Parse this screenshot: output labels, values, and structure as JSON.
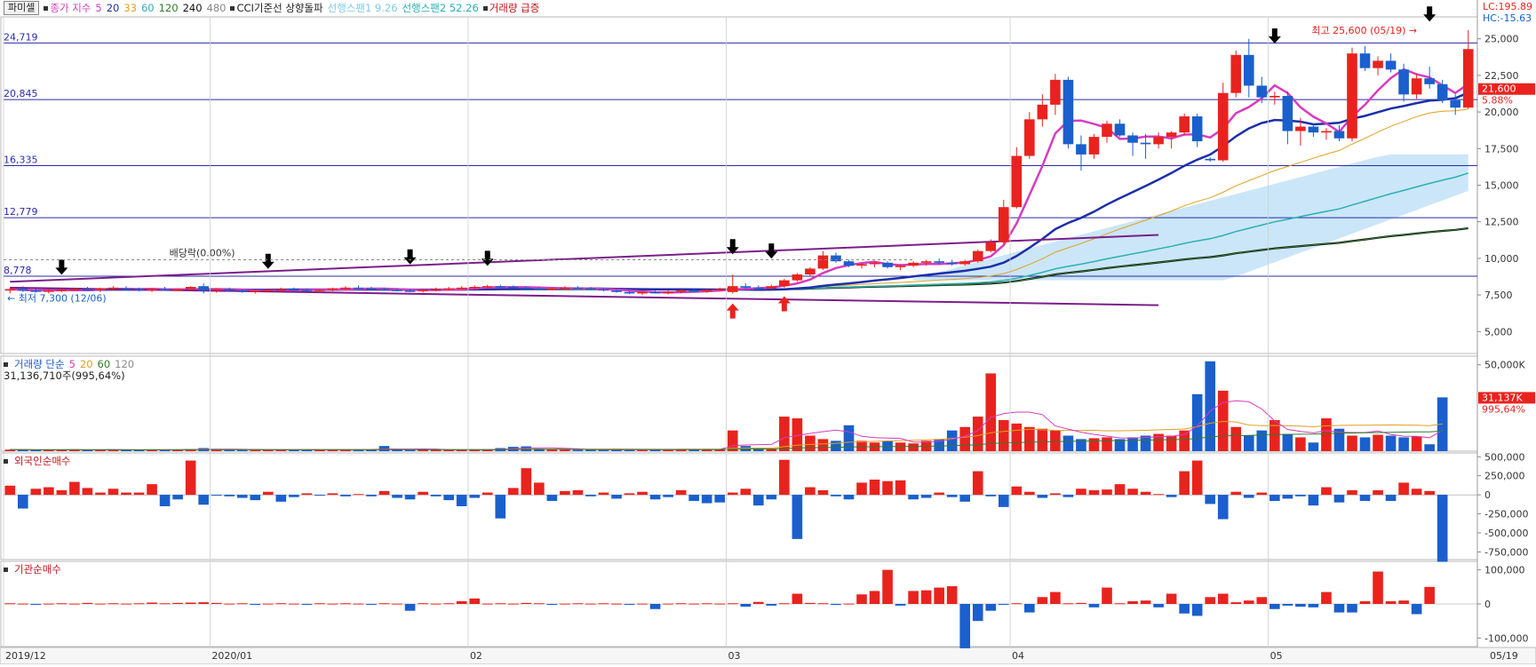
{
  "legend": {
    "stock_tag": "파미셀",
    "price_label": "종가 지수",
    "ma_periods": [
      "5",
      "20",
      "33",
      "60",
      "120",
      "240",
      "480"
    ],
    "ma_colors": [
      "#d63cc0",
      "#1b2fa8",
      "#e0a020",
      "#2ab0b0",
      "#2f7a2f",
      "#111111",
      "#888888"
    ],
    "cci_label": "CCI기준선 상향돌파",
    "span1_label": "선행스팬1 9.26",
    "span2_label": "선행스팬2 52.26",
    "vol_surge_label": "거래량 급증"
  },
  "price_info": {
    "lc": "LC:195.89",
    "hc": "HC:-15.63"
  },
  "colors": {
    "up": "#e8231e",
    "down": "#1a5fcc",
    "hline": "#2a2aa8",
    "span": "#8cc8f0",
    "conv": "#5fc8e0",
    "purple": "#7a1e8a"
  },
  "chart_data": [
    {
      "type": "candlestick",
      "pane": "price",
      "ylim": [
        3500,
        26500
      ],
      "yticks": [
        "25,000",
        "22,500",
        "20,000",
        "17,500",
        "15,000",
        "12,500",
        "10,000",
        "7,500",
        "5,000"
      ],
      "ytick_values": [
        25000,
        22500,
        20000,
        17500,
        15000,
        12500,
        10000,
        7500,
        5000
      ],
      "hlines": [
        {
          "label": "24,719",
          "value": 24719
        },
        {
          "label": "20,845",
          "value": 20845
        },
        {
          "label": "16,335",
          "value": 16335
        },
        {
          "label": "12,779",
          "value": 12779
        },
        {
          "label": "8,778",
          "value": 8778
        }
      ],
      "current_price": {
        "label": "21,600",
        "value": 21600,
        "pct": "5.88%"
      },
      "annotations": {
        "high": "최고 25,600 (05/19)",
        "low": "최저 7,300 (12/06)",
        "dividend": "배당락(0.00%)"
      },
      "x_labels": [
        {
          "label": "2019/12",
          "i": 0
        },
        {
          "label": "2020/01",
          "i": 16
        },
        {
          "label": "02",
          "i": 36
        },
        {
          "label": "03",
          "i": 56
        },
        {
          "label": "04",
          "i": 78
        },
        {
          "label": "05",
          "i": 98
        },
        {
          "label": "05/19",
          "i": 109
        }
      ],
      "candles": [
        [
          7800,
          8000,
          7600,
          7900
        ],
        [
          7900,
          8100,
          7700,
          7800
        ],
        [
          7800,
          7950,
          7650,
          7750
        ],
        [
          7750,
          7900,
          7600,
          7800
        ],
        [
          7800,
          7950,
          7700,
          7850
        ],
        [
          7850,
          8000,
          7750,
          7900
        ],
        [
          7900,
          8050,
          7800,
          7850
        ],
        [
          7850,
          8000,
          7700,
          7950
        ],
        [
          7950,
          8100,
          7850,
          8000
        ],
        [
          7950,
          8100,
          7800,
          7900
        ],
        [
          7900,
          8000,
          7750,
          7800
        ],
        [
          7800,
          7950,
          7700,
          7900
        ],
        [
          7900,
          8050,
          7800,
          7850
        ],
        [
          7850,
          7950,
          7750,
          7900
        ],
        [
          7900,
          8100,
          7800,
          8050
        ],
        [
          8100,
          8300,
          7600,
          7800
        ],
        [
          7800,
          7950,
          7650,
          7900
        ],
        [
          7900,
          8000,
          7750,
          7800
        ],
        [
          7800,
          7900,
          7650,
          7700
        ],
        [
          7700,
          7850,
          7600,
          7800
        ],
        [
          7800,
          7950,
          7700,
          7850
        ],
        [
          7850,
          8000,
          7750,
          7900
        ],
        [
          7900,
          8000,
          7800,
          7850
        ],
        [
          7850,
          7950,
          7750,
          7800
        ],
        [
          7800,
          7900,
          7700,
          7850
        ],
        [
          7850,
          8000,
          7750,
          7950
        ],
        [
          7950,
          8100,
          7850,
          8000
        ],
        [
          8000,
          8150,
          7900,
          7950
        ],
        [
          7950,
          8050,
          7850,
          7900
        ],
        [
          7900,
          8000,
          7800,
          7850
        ],
        [
          7850,
          7950,
          7750,
          7800
        ],
        [
          7800,
          7900,
          7700,
          7750
        ],
        [
          7750,
          7900,
          7650,
          7850
        ],
        [
          7850,
          8000,
          7750,
          7900
        ],
        [
          7900,
          8050,
          7800,
          7950
        ],
        [
          7950,
          8100,
          7850,
          8000
        ],
        [
          8000,
          8150,
          7900,
          8050
        ],
        [
          8050,
          8200,
          7950,
          8100
        ],
        [
          8100,
          8200,
          8000,
          8050
        ],
        [
          8050,
          8150,
          7950,
          8000
        ],
        [
          8000,
          8100,
          7900,
          7950
        ],
        [
          7950,
          8050,
          7850,
          7900
        ],
        [
          7900,
          8000,
          7800,
          7950
        ],
        [
          7950,
          8100,
          7850,
          8000
        ],
        [
          8000,
          8100,
          7900,
          7950
        ],
        [
          7950,
          8050,
          7850,
          7900
        ],
        [
          7900,
          8000,
          7750,
          7800
        ],
        [
          7800,
          7900,
          7650,
          7700
        ],
        [
          7700,
          7800,
          7550,
          7600
        ],
        [
          7600,
          7750,
          7500,
          7700
        ],
        [
          7700,
          7800,
          7600,
          7650
        ],
        [
          7650,
          7800,
          7550,
          7700
        ],
        [
          7700,
          7850,
          7600,
          7800
        ],
        [
          7800,
          7900,
          7700,
          7750
        ],
        [
          7750,
          7900,
          7650,
          7850
        ],
        [
          7850,
          8000,
          7750,
          7900
        ],
        [
          7700,
          8900,
          7600,
          8100
        ],
        [
          8100,
          8300,
          7900,
          8000
        ],
        [
          8000,
          8150,
          7850,
          7950
        ],
        [
          7950,
          8200,
          7850,
          8100
        ],
        [
          8100,
          8600,
          8000,
          8500
        ],
        [
          8500,
          9000,
          8400,
          8900
        ],
        [
          8900,
          9400,
          8800,
          9300
        ],
        [
          9300,
          10500,
          9200,
          10200
        ],
        [
          10200,
          10400,
          9700,
          9800
        ],
        [
          9800,
          9900,
          9400,
          9500
        ],
        [
          9500,
          9700,
          9300,
          9600
        ],
        [
          9600,
          9800,
          9400,
          9700
        ],
        [
          9700,
          9800,
          9300,
          9400
        ],
        [
          9400,
          9600,
          9200,
          9500
        ],
        [
          9500,
          9800,
          9400,
          9700
        ],
        [
          9700,
          9900,
          9500,
          9800
        ],
        [
          9800,
          10000,
          9600,
          9700
        ],
        [
          9700,
          9900,
          9500,
          9600
        ],
        [
          9600,
          9900,
          9500,
          9800
        ],
        [
          9800,
          10600,
          9700,
          10500
        ],
        [
          10500,
          11300,
          10400,
          11100
        ],
        [
          11100,
          14000,
          11000,
          13500
        ],
        [
          13500,
          17600,
          13400,
          17000
        ],
        [
          17000,
          20000,
          16800,
          19500
        ],
        [
          19500,
          21200,
          19000,
          20500
        ],
        [
          20500,
          22600,
          19800,
          22200
        ],
        [
          22200,
          22400,
          17500,
          17800
        ],
        [
          17800,
          18400,
          16000,
          17100
        ],
        [
          17100,
          18500,
          16800,
          18300
        ],
        [
          18300,
          19400,
          17900,
          19200
        ],
        [
          19200,
          19500,
          18300,
          18400
        ],
        [
          18400,
          18600,
          17000,
          17900
        ],
        [
          17900,
          18500,
          16800,
          17800
        ],
        [
          17800,
          18600,
          17500,
          18300
        ],
        [
          18300,
          18700,
          17500,
          18600
        ],
        [
          18600,
          19900,
          18400,
          19700
        ],
        [
          19700,
          19900,
          17600,
          18000
        ],
        [
          16800,
          16900,
          16600,
          16700
        ],
        [
          16700,
          22000,
          16600,
          21300
        ],
        [
          21300,
          24200,
          21000,
          23900
        ],
        [
          23900,
          25000,
          21000,
          21800
        ],
        [
          21800,
          22400,
          20600,
          21000
        ],
        [
          21000,
          21400,
          20500,
          21100
        ],
        [
          21100,
          21400,
          17800,
          18700
        ],
        [
          18700,
          19600,
          17700,
          19000
        ],
        [
          19000,
          19200,
          18300,
          18600
        ],
        [
          18600,
          18900,
          18100,
          18700
        ],
        [
          18700,
          19100,
          18000,
          18200
        ],
        [
          18200,
          24400,
          18000,
          24000
        ],
        [
          24000,
          24500,
          22800,
          23000
        ],
        [
          23000,
          23800,
          22500,
          23500
        ],
        [
          23500,
          24000,
          22700,
          22900
        ],
        [
          22900,
          23300,
          20700,
          21200
        ],
        [
          21200,
          22600,
          20900,
          22300
        ],
        [
          22300,
          23100,
          21600,
          21900
        ],
        [
          21900,
          22200,
          20600,
          20800
        ],
        [
          20800,
          21200,
          19800,
          20300
        ],
        [
          20300,
          25600,
          20200,
          24300
        ]
      ]
    },
    {
      "type": "bar",
      "pane": "volume",
      "title": "거래량 단순",
      "ma_periods": [
        "5",
        "20",
        "60",
        "120"
      ],
      "ma_colors": [
        "#d63cc0",
        "#e0a020",
        "#2f7a2f",
        "#888888"
      ],
      "summary": "31,136,710주(995,64%)",
      "ylim": [
        0,
        55000
      ],
      "yticks": [
        "50,000K"
      ],
      "ytick_values": [
        50000
      ],
      "current": {
        "label": "31,137K",
        "pct": "995,64%",
        "value": 31137
      },
      "values": [
        900,
        800,
        700,
        800,
        900,
        1000,
        800,
        700,
        900,
        800,
        700,
        800,
        900,
        1000,
        1200,
        1800,
        900,
        800,
        700,
        800,
        900,
        800,
        700,
        800,
        900,
        1000,
        800,
        700,
        900,
        3000,
        800,
        700,
        900,
        800,
        700,
        800,
        900,
        1000,
        1800,
        2500,
        2800,
        1500,
        900,
        800,
        700,
        800,
        900,
        1000,
        800,
        700,
        900,
        800,
        1200,
        900,
        1000,
        1100,
        12000,
        3000,
        2000,
        1500,
        20000,
        19000,
        9000,
        7000,
        6000,
        15000,
        6000,
        5000,
        6000,
        5000,
        4500,
        6000,
        7000,
        12000,
        14000,
        20000,
        45000,
        18000,
        16000,
        14000,
        13000,
        12000,
        9000,
        7000,
        7500,
        8000,
        7000,
        8000,
        9000,
        10000,
        9000,
        12000,
        33000,
        52000,
        35000,
        14000,
        9000,
        12000,
        18000,
        10000,
        8000,
        5000,
        19000,
        13000,
        9000,
        8000,
        9500,
        9000,
        8000,
        8500,
        4000,
        31137
      ]
    },
    {
      "type": "bar",
      "pane": "foreign",
      "title": "외국인순매수",
      "ylim": [
        -850000,
        550000
      ],
      "yticks": [
        "500,000",
        "250,000",
        "0",
        "-250,000",
        "-500,000",
        "-750,000"
      ],
      "ytick_values": [
        500000,
        250000,
        0,
        -250000,
        -500000,
        -750000
      ],
      "values": [
        120000,
        -180000,
        80000,
        100000,
        60000,
        170000,
        90000,
        30000,
        80000,
        30000,
        30000,
        140000,
        -150000,
        -60000,
        450000,
        -130000,
        -10000,
        -20000,
        -40000,
        -70000,
        40000,
        -90000,
        -30000,
        20000,
        -10000,
        20000,
        -20000,
        10000,
        -20000,
        50000,
        -40000,
        -60000,
        40000,
        -20000,
        -70000,
        -150000,
        -40000,
        30000,
        -310000,
        90000,
        350000,
        160000,
        -80000,
        50000,
        60000,
        -20000,
        30000,
        -50000,
        20000,
        40000,
        -60000,
        -30000,
        60000,
        -80000,
        -110000,
        -100000,
        30000,
        80000,
        -140000,
        -60000,
        460000,
        -580000,
        100000,
        60000,
        -20000,
        -60000,
        160000,
        200000,
        180000,
        190000,
        -60000,
        -40000,
        30000,
        -30000,
        -90000,
        310000,
        -20000,
        -160000,
        110000,
        40000,
        -40000,
        20000,
        -30000,
        80000,
        60000,
        70000,
        140000,
        80000,
        40000,
        10000,
        -30000,
        310000,
        450000,
        -120000,
        -320000,
        40000,
        -40000,
        30000,
        -80000,
        -50000,
        -20000,
        -140000,
        100000,
        -100000,
        60000,
        -80000,
        60000,
        -80000,
        160000,
        80000,
        50000,
        -880000
      ]
    },
    {
      "type": "bar",
      "pane": "institution",
      "title": "기관순매수",
      "ylim": [
        -125000,
        125000
      ],
      "yticks": [
        "100,000",
        "0",
        "-100,000"
      ],
      "ytick_values": [
        100000,
        0,
        -100000
      ],
      "values": [
        2000,
        1000,
        -1000,
        1000,
        2000,
        1000,
        3000,
        1000,
        2000,
        1000,
        2000,
        4000,
        2000,
        3000,
        4000,
        5000,
        3000,
        1000,
        2000,
        -2000,
        1000,
        2000,
        1000,
        -1000,
        2000,
        1000,
        2000,
        1000,
        -1000,
        2000,
        1000,
        -20000,
        2000,
        1000,
        2000,
        8000,
        16000,
        1000,
        2000,
        1000,
        3000,
        2000,
        -1000,
        1000,
        2000,
        1000,
        2000,
        1000,
        -2000,
        1000,
        -15000,
        1000,
        2000,
        1000,
        2000,
        1000,
        2000,
        -8000,
        6000,
        -5000,
        2000,
        30000,
        3000,
        2000,
        -3000,
        1000,
        28000,
        38000,
        100000,
        -5000,
        38000,
        40000,
        48000,
        52000,
        -130000,
        -50000,
        -20000,
        -2000,
        2000,
        -25000,
        20000,
        35000,
        2000,
        3000,
        -10000,
        48000,
        2000,
        8000,
        10000,
        -10000,
        30000,
        -28000,
        -35000,
        20000,
        30000,
        5000,
        10000,
        20000,
        -15000,
        -5000,
        -8000,
        -10000,
        35000,
        -25000,
        -25000,
        8000,
        95000,
        8000,
        10000,
        -30000,
        50000
      ]
    }
  ]
}
